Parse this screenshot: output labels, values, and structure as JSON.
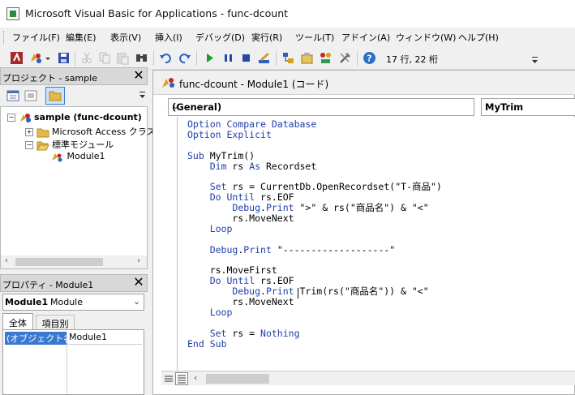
{
  "window": {
    "title": "Microsoft Visual Basic for Applications - func-dcount"
  },
  "menu": [
    "ファイル(F)",
    "編集(E)",
    "表示(V)",
    "挿入(I)",
    "デバッグ(D)",
    "実行(R)",
    "ツール(T)",
    "アドイン(A)",
    "ウィンドウ(W)",
    "ヘルプ(H)"
  ],
  "toolbar": {
    "status": "17 行, 22 桁",
    "icons": [
      "access-view-icon",
      "insert-module-icon",
      "dropdown-arrow-icon",
      "save-icon",
      "cut-icon",
      "copy-icon",
      "paste-icon",
      "find-icon",
      "undo-icon",
      "redo-icon",
      "run-icon",
      "break-icon",
      "reset-icon",
      "design-mode-icon",
      "project-explorer-icon",
      "properties-icon",
      "object-browser-icon",
      "toolbox-icon",
      "help-icon"
    ],
    "colors": {
      "run": "#1a9e2c",
      "stop": "#2748a8",
      "help": "#2d6fc4"
    }
  },
  "project": {
    "title": "プロジェクト - sample",
    "root": "sample (func-dcount)",
    "items": [
      "Microsoft Access クラス",
      "標準モジュール",
      "Module1"
    ]
  },
  "properties": {
    "title": "プロパティ - Module1",
    "object_name": "Module1",
    "object_type": "Module",
    "tabs": [
      "全体",
      "項目別"
    ],
    "row_key": "(オブジェクト名)",
    "row_value": "Module1"
  },
  "code": {
    "title": "func-dcount - Module1 (コード)",
    "object_combo": "(General)",
    "proc_combo": "MyTrim",
    "keyword_color": "#1f3fa8",
    "lines": [
      "Option Compare Database",
      "Option Explicit",
      "",
      "Sub MyTrim()",
      "    Dim rs As Recordset",
      "",
      "    Set rs = CurrentDb.OpenRecordset(\"T-商品\")",
      "    Do Until rs.EOF",
      "        Debug.Print \">\" & rs(\"商品名\") & \"<\"",
      "        rs.MoveNext",
      "    Loop",
      "",
      "    Debug.Print \"-------------------\"",
      "",
      "    rs.MoveFirst",
      "    Do Until rs.EOF",
      "        Debug.Print Trim(rs(\"商品名\")) & \"<\"",
      "        rs.MoveNext",
      "    Loop",
      "",
      "    Set rs = Nothing",
      "End Sub"
    ]
  }
}
